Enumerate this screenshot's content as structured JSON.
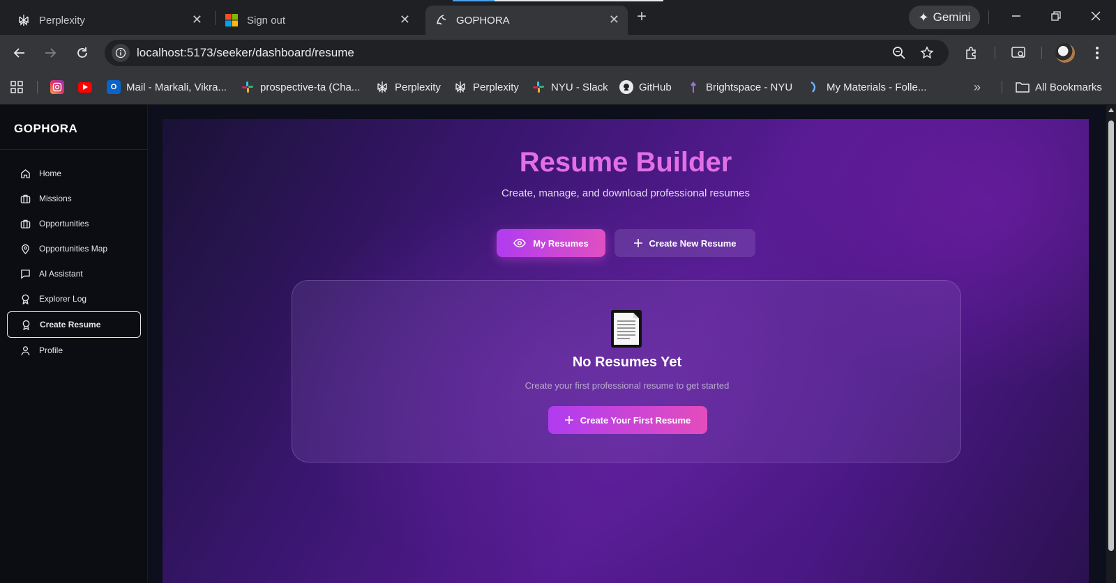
{
  "browser": {
    "tabs": [
      {
        "title": "Perplexity",
        "icon": "perplexity-icon",
        "active": false
      },
      {
        "title": "Sign out",
        "icon": "microsoft-icon",
        "active": false
      },
      {
        "title": "GOPHORA",
        "icon": "gophora-icon",
        "active": true
      }
    ],
    "gemini_label": "Gemini",
    "url": "localhost:5173/seeker/dashboard/resume",
    "bookmarks": [
      {
        "label": "",
        "icon": "instagram-icon"
      },
      {
        "label": "",
        "icon": "youtube-icon"
      },
      {
        "label": "Mail - Markali, Vikra...",
        "icon": "outlook-icon"
      },
      {
        "label": "prospective-ta (Cha...",
        "icon": "slack-icon"
      },
      {
        "label": "Perplexity",
        "icon": "perplexity-icon"
      },
      {
        "label": "Perplexity",
        "icon": "perplexity-icon"
      },
      {
        "label": "NYU - Slack",
        "icon": "slack-icon"
      },
      {
        "label": "GitHub",
        "icon": "github-icon"
      },
      {
        "label": "Brightspace - NYU",
        "icon": "brightspace-icon"
      },
      {
        "label": "My Materials - Folle...",
        "icon": "follett-icon"
      }
    ],
    "all_bookmarks_label": "All Bookmarks",
    "colors": {
      "chrome_bg": "#1f2023",
      "toolbar_bg": "#35363a",
      "loading_accent": "#4a9fe8"
    }
  },
  "app": {
    "brand": "GOPHORA",
    "nav": [
      {
        "label": "Home",
        "icon": "home-icon",
        "active": false
      },
      {
        "label": "Missions",
        "icon": "briefcase-icon",
        "active": false
      },
      {
        "label": "Opportunities",
        "icon": "briefcase-icon",
        "active": false
      },
      {
        "label": "Opportunities Map",
        "icon": "map-pin-icon",
        "active": false
      },
      {
        "label": "AI Assistant",
        "icon": "chat-icon",
        "active": false
      },
      {
        "label": "Explorer Log",
        "icon": "award-icon",
        "active": false
      },
      {
        "label": "Create Resume",
        "icon": "award-icon",
        "active": true
      },
      {
        "label": "Profile",
        "icon": "user-icon",
        "active": false
      }
    ],
    "page": {
      "title": "Resume Builder",
      "subtitle": "Create, manage, and download professional resumes",
      "btn_my_resumes": "My Resumes",
      "btn_create_new": "Create New Resume",
      "empty_title": "No Resumes Yet",
      "empty_subtitle": "Create your first professional resume to get started",
      "btn_create_first": "Create Your First Resume"
    },
    "colors": {
      "title": "#e36fe6",
      "primary_gradient_start": "#b03cf0",
      "primary_gradient_end": "#e04fc2",
      "sidebar_bg": "#0c0d12"
    }
  }
}
